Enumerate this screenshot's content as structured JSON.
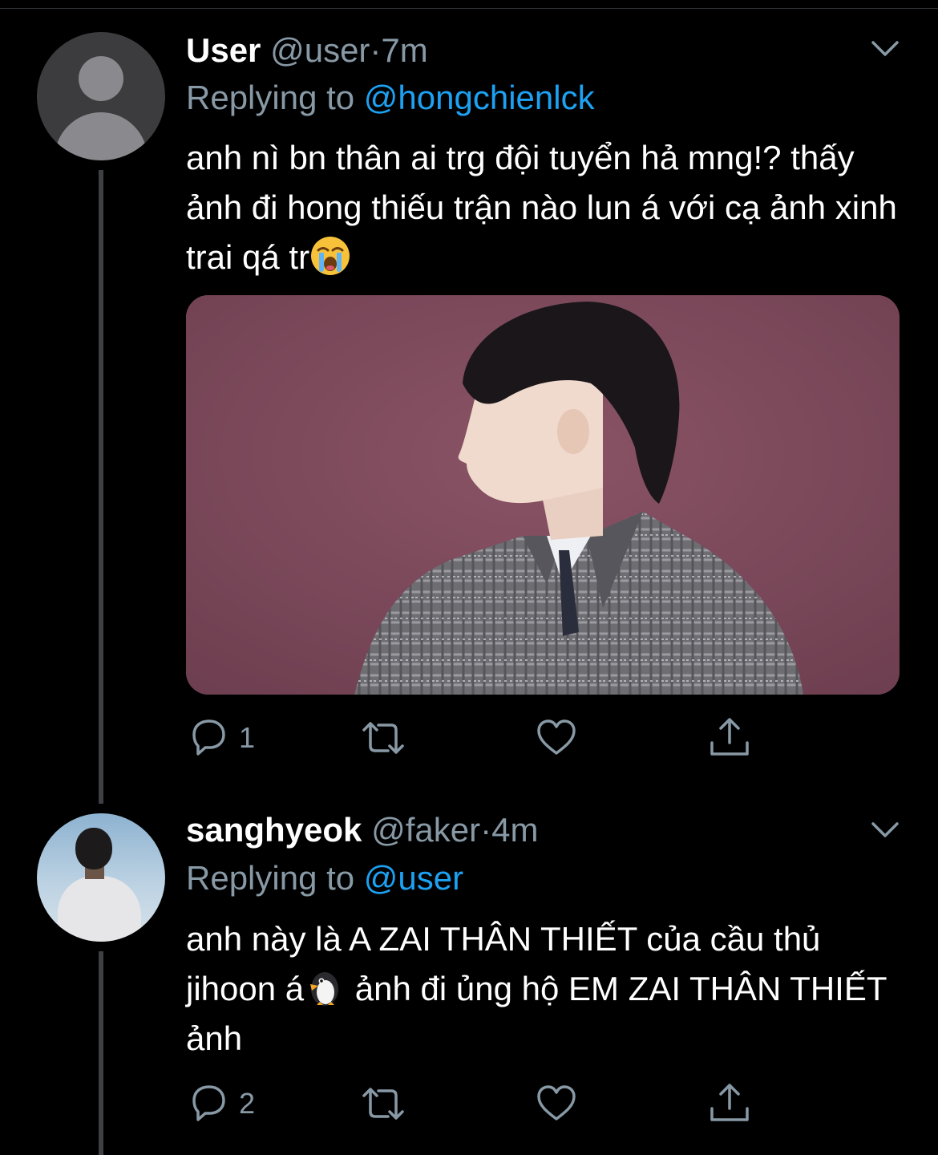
{
  "colors": {
    "background": "#000000",
    "text": "#ffffff",
    "muted": "#8899a6",
    "link": "#1da1f2",
    "thread_line": "#3d4145"
  },
  "tweets": [
    {
      "name": "User",
      "handle": "@user",
      "sep": "·",
      "time": "7m",
      "replying_prefix": "Replying to",
      "replying_to": "@hongchienlck",
      "text_before_emoji": "anh nì bn thân ai trg đội tuyển hả mng!? thấy ảnh đi hong thiếu trận nào lun á với cạ ảnh xinh trai qá tr",
      "emoji": "loudly-crying-face-emoji",
      "has_media": true,
      "reply_count": "1",
      "icons": [
        "reply-icon",
        "retweet-icon",
        "like-icon",
        "share-icon",
        "chevron-down-icon"
      ]
    },
    {
      "name": "sanghyeok",
      "handle": "@faker",
      "sep": "·",
      "time": "4m",
      "replying_prefix": "Replying to",
      "replying_to": "@user",
      "text_before_emoji": "anh này là A ZAI THÂN THIẾT của cầu thủ jihoon á",
      "emoji": "penguin-emoji",
      "text_after_emoji": " ảnh đi ủng hộ EM ZAI THÂN THIẾT ảnh",
      "has_media": false,
      "reply_count": "2",
      "icons": [
        "reply-icon",
        "retweet-icon",
        "like-icon",
        "share-icon",
        "chevron-down-icon"
      ]
    }
  ]
}
